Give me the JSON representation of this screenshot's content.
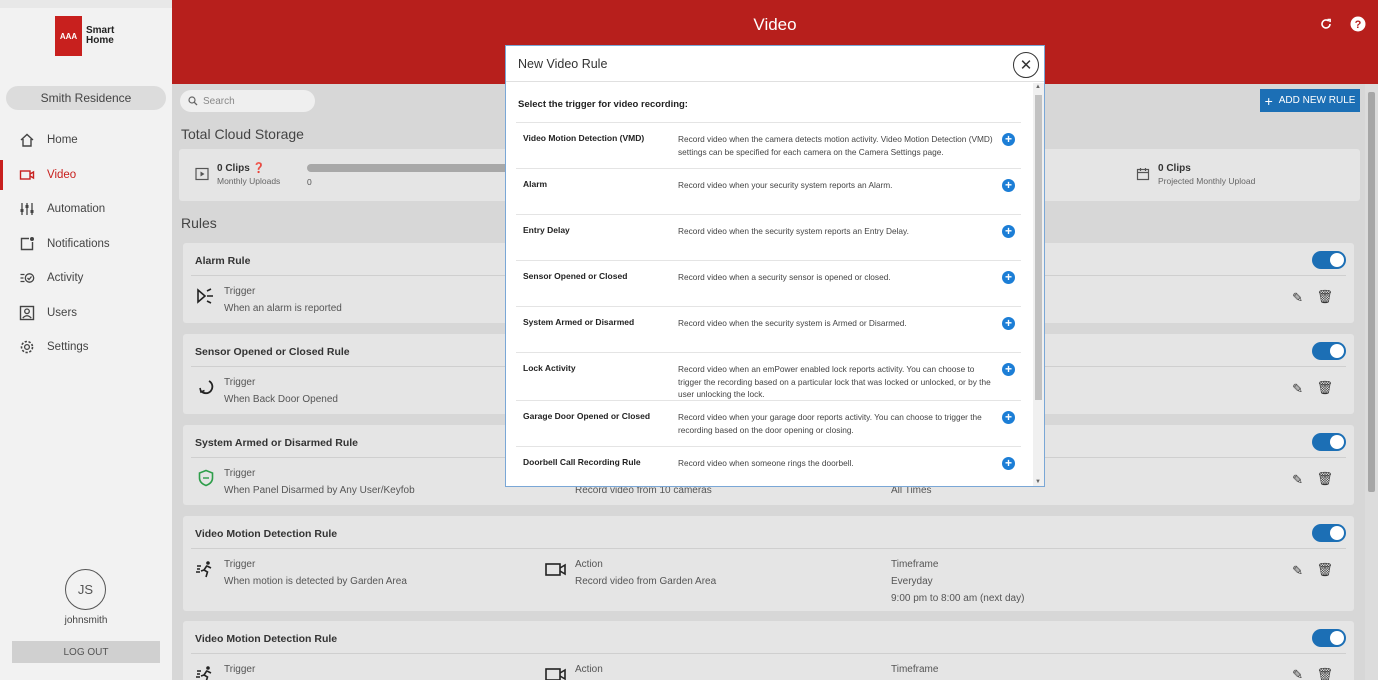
{
  "app": {
    "logo_badge": "AAA",
    "logo_line1": "Smart",
    "logo_line2": "Home",
    "residence": "Smith Residence"
  },
  "sidebar": {
    "items": [
      {
        "label": "Home",
        "icon": "home-icon"
      },
      {
        "label": "Video",
        "icon": "video-icon",
        "active": true
      },
      {
        "label": "Automation",
        "icon": "sliders-icon"
      },
      {
        "label": "Notifications",
        "icon": "notification-icon"
      },
      {
        "label": "Activity",
        "icon": "activity-icon"
      },
      {
        "label": "Users",
        "icon": "user-icon"
      },
      {
        "label": "Settings",
        "icon": "gear-icon"
      }
    ],
    "initials": "JS",
    "username": "johnsmith",
    "logout": "LOG OUT"
  },
  "header": {
    "title": "Video",
    "accent_color": "#b71f1c"
  },
  "toolbar": {
    "search_placeholder": "Search",
    "add_rule": "ADD NEW RULE"
  },
  "storage": {
    "title": "Total Cloud Storage",
    "left_count": "0 Clips",
    "left_sub": "Monthly Uploads",
    "left_value": "0",
    "right_count": "0 Clips",
    "right_sub": "Projected Monthly Upload"
  },
  "rules": {
    "title": "Rules",
    "items": [
      {
        "name": "Alarm Rule",
        "trigger_label": "Trigger",
        "trigger_text": "When an alarm is reported"
      },
      {
        "name": "Sensor Opened or Closed Rule",
        "trigger_label": "Trigger",
        "trigger_text": "When Back Door Opened"
      },
      {
        "name": "System Armed or Disarmed Rule",
        "trigger_label": "Trigger",
        "trigger_text": "When Panel Disarmed by Any User/Keyfob",
        "action_text": "Record video from 10 cameras",
        "time_text": "All Times"
      },
      {
        "name": "Video Motion Detection Rule",
        "trigger_label": "Trigger",
        "trigger_text": "When motion is detected by Garden Area",
        "action_label": "Action",
        "action_text": "Record video from Garden Area",
        "time_label": "Timeframe",
        "time_text": "Everyday",
        "time_text2": "9:00 pm to 8:00 am (next day)"
      },
      {
        "name": "Video Motion Detection Rule",
        "trigger_label": "Trigger",
        "action_label": "Action",
        "time_label": "Timeframe"
      }
    ]
  },
  "modal": {
    "title": "New Video Rule",
    "subtitle": "Select the trigger for video recording:",
    "triggers": [
      {
        "name": "Video Motion Detection (VMD)",
        "desc": "Record video when the camera detects motion activity. Video Motion Detection (VMD) settings can be specified for each camera on the Camera Settings page."
      },
      {
        "name": "Alarm",
        "desc": "Record video when your security system reports an Alarm."
      },
      {
        "name": "Entry Delay",
        "desc": "Record video when the security system reports an Entry Delay."
      },
      {
        "name": "Sensor Opened or Closed",
        "desc": "Record video when a security sensor is opened or closed."
      },
      {
        "name": "System Armed or Disarmed",
        "desc": "Record video when the security system is Armed or Disarmed."
      },
      {
        "name": "Lock Activity",
        "desc": "Record video when an emPower enabled lock reports activity. You can choose to trigger the recording based on a particular lock that was locked or unlocked, or by the user unlocking the lock."
      },
      {
        "name": "Garage Door Opened or Closed",
        "desc": "Record video when your garage door reports activity. You can choose to trigger the recording based on the door opening or closing."
      },
      {
        "name": "Doorbell Call Recording Rule",
        "desc": "Record video when someone rings the doorbell."
      }
    ]
  }
}
